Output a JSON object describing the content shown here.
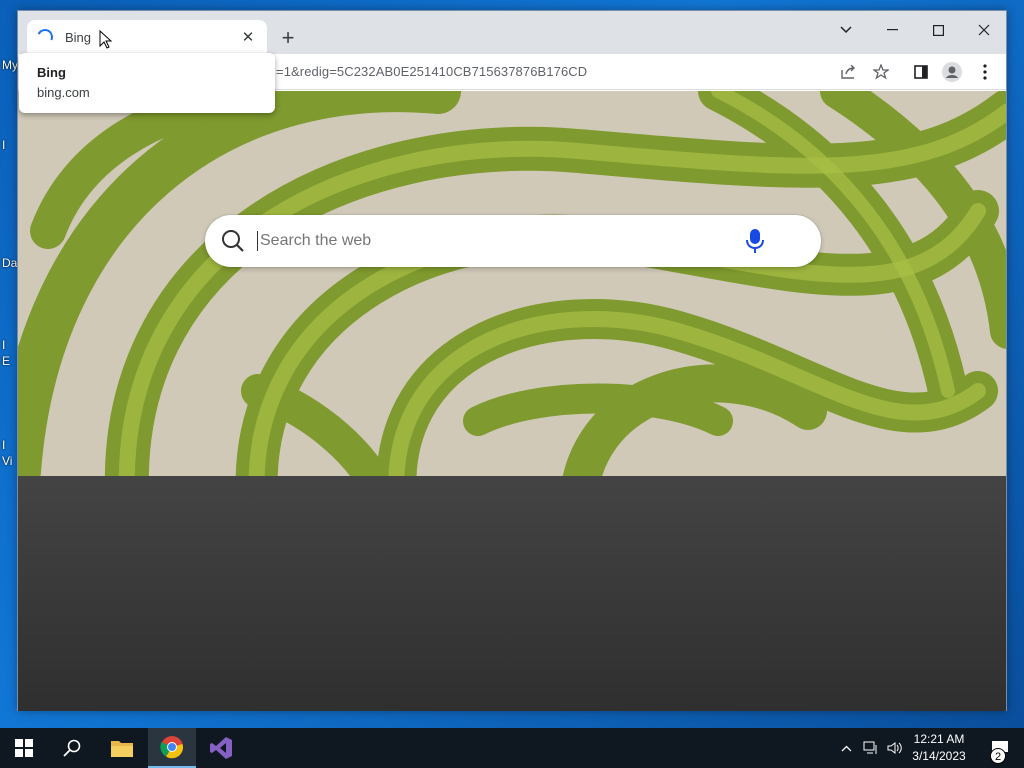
{
  "desktop": {
    "labels": [
      "My",
      "I",
      "Da",
      "I",
      "E",
      "I",
      "Vi"
    ]
  },
  "browser": {
    "tab": {
      "title": "Bing"
    },
    "new_tab_label": "+",
    "url": "=1&redig=5C232AB0E251410CB715637876B176CD",
    "hovercard": {
      "title": "Bing",
      "url": "bing.com"
    }
  },
  "page": {
    "search": {
      "placeholder": "Search the web",
      "value": ""
    }
  },
  "taskbar": {
    "time": "12:21 AM",
    "date": "3/14/2023",
    "notifications": "2"
  }
}
